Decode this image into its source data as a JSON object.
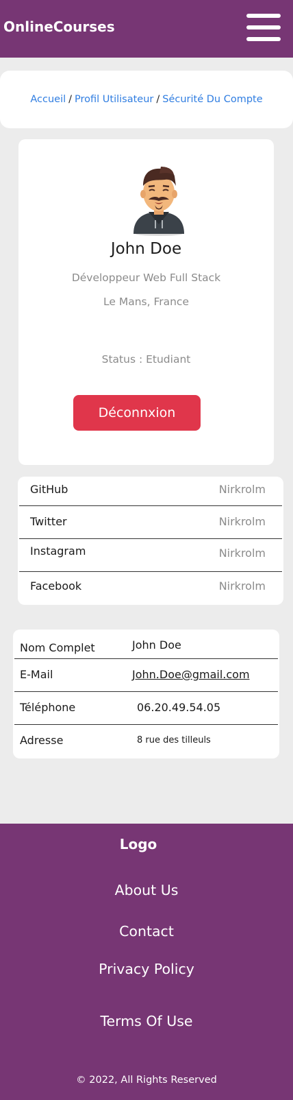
{
  "navbar": {
    "brand": "OnlineCourses",
    "menu_icon": "hamburger-menu-icon",
    "color": "#773674"
  },
  "breadcrumb": {
    "items": [
      "Accueil",
      "Profil Utilisateur",
      "Sécurité Du Compte"
    ],
    "separator": "/"
  },
  "profile": {
    "name": "John Doe",
    "job": "Développeur Web Full Stack",
    "location": "Le Mans, France",
    "status": "Status : Etudiant",
    "logout_label": "Déconnxion",
    "logout_color": "#e0364b",
    "avatar_icon": "bearded-man-avatar"
  },
  "social": {
    "rows": [
      {
        "name": "GitHub",
        "value": "Nirkrolm"
      },
      {
        "name": "Twitter",
        "value": "Nirkrolm"
      },
      {
        "name": "Instagram",
        "value": "Nirkrolm"
      },
      {
        "name": "Facebook",
        "value": "Nirkrolm"
      }
    ]
  },
  "info": {
    "rows": [
      {
        "label": "Nom Complet",
        "value": "John Doe"
      },
      {
        "label": "E-Mail",
        "value": "John.Doe@gmail.com"
      },
      {
        "label": "Téléphone",
        "value": "06.20.49.54.05"
      },
      {
        "label": "Adresse",
        "value": "8 rue des tilleuls"
      }
    ]
  },
  "footer": {
    "logo": "Logo",
    "links": [
      "About Us",
      "Contact",
      "Privacy Policy",
      "Terms Of Use"
    ],
    "copyright": "© 2022,  All Rights Reserved"
  }
}
